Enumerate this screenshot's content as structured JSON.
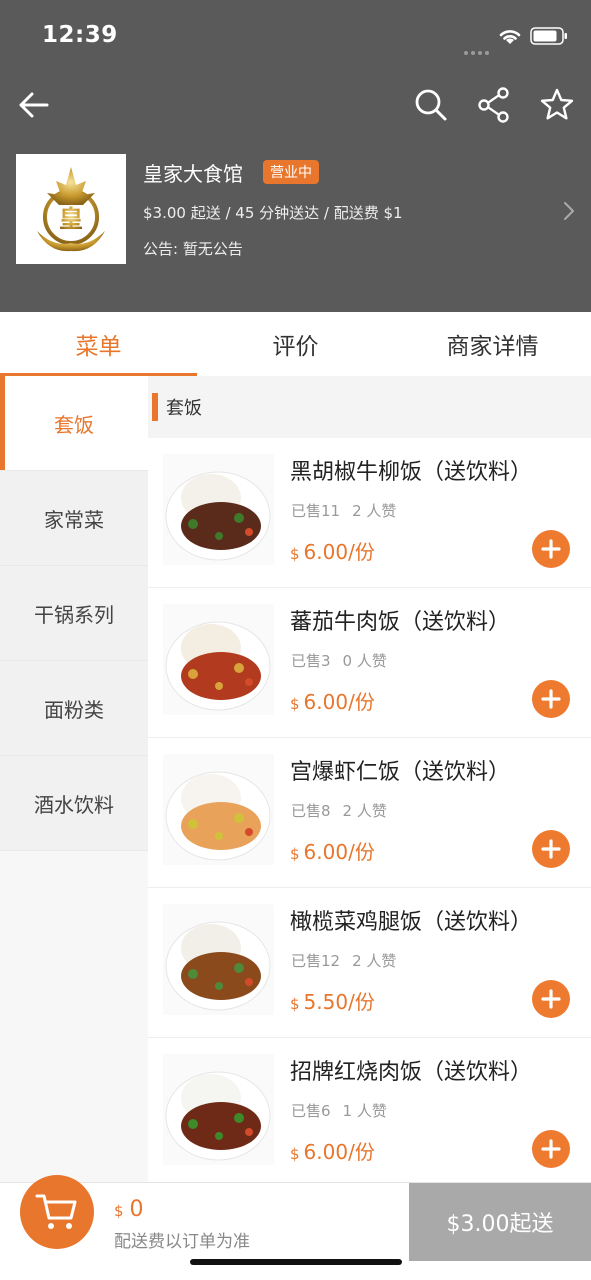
{
  "status_bar": {
    "time": "12:39"
  },
  "nav": {
    "back_icon": "arrow-left-icon",
    "search_icon": "search-icon",
    "share_icon": "share-icon",
    "favorite_icon": "star-icon"
  },
  "shop": {
    "logo_text": "皇",
    "name": "皇家大食馆",
    "status_badge": "营业中",
    "meta": "$3.00 起送 / 45 分钟送达 / 配送费 $1",
    "notice": "公告: 暂无公告"
  },
  "tabs": [
    {
      "label": "菜单",
      "active": true
    },
    {
      "label": "评价",
      "active": false
    },
    {
      "label": "商家详情",
      "active": false
    }
  ],
  "categories": [
    {
      "label": "套饭",
      "active": true
    },
    {
      "label": "家常菜",
      "active": false
    },
    {
      "label": "干锅系列",
      "active": false
    },
    {
      "label": "面粉类",
      "active": false
    },
    {
      "label": "酒水饮料",
      "active": false
    }
  ],
  "section_title": "套饭",
  "dishes": [
    {
      "name": "黑胡椒牛柳饭（送饮料）",
      "sold": "已售11",
      "likes": "2 人赞",
      "currency": "$",
      "price": "6.00/份",
      "plate_colors": [
        "#5a2a1a",
        "#f4f1ea",
        "#3f7a2a"
      ]
    },
    {
      "name": "蕃茄牛肉饭（送饮料）",
      "sold": "已售3",
      "likes": "0 人赞",
      "currency": "$",
      "price": "6.00/份",
      "plate_colors": [
        "#b23a1e",
        "#f3ede2",
        "#d8a33a"
      ]
    },
    {
      "name": "宫爆虾仁饭（送饮料）",
      "sold": "已售8",
      "likes": "2 人赞",
      "currency": "$",
      "price": "6.00/份",
      "plate_colors": [
        "#e9a25a",
        "#f7f3ee",
        "#cfc23a"
      ]
    },
    {
      "name": "橄榄菜鸡腿饭（送饮料）",
      "sold": "已售12",
      "likes": "2 人赞",
      "currency": "$",
      "price": "5.50/份",
      "plate_colors": [
        "#8a4a1c",
        "#f2efe8",
        "#4f8a3a"
      ]
    },
    {
      "name": "招牌红烧肉饭（送饮料）",
      "sold": "已售6",
      "likes": "1 人赞",
      "currency": "$",
      "price": "6.00/份",
      "plate_colors": [
        "#6e2a16",
        "#f5f5f2",
        "#3e8a2a"
      ]
    }
  ],
  "cart": {
    "currency": "$",
    "total": "0",
    "note": "配送费以订单为准",
    "checkout_label": "$3.00起送"
  },
  "colors": {
    "accent": "#e8762d",
    "header_bg": "#5a5a5a",
    "checkout_disabled": "#a9a9a9"
  }
}
